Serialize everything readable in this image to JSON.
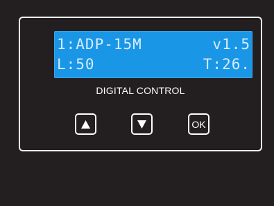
{
  "display": {
    "line1_left": "1:ADP-15M",
    "line1_right": "v1.5",
    "line2_left": "L:50",
    "line2_right": "T:26."
  },
  "panel": {
    "label": "DIGITAL CONTROL"
  },
  "buttons": {
    "up_icon": "up-triangle-icon",
    "down_icon": "down-triangle-icon",
    "ok_label": "OK"
  },
  "colors": {
    "background": "#231f20",
    "lcd": "#1a96e6",
    "lcd_text": "#d6ecff",
    "border": "#ffffff"
  }
}
